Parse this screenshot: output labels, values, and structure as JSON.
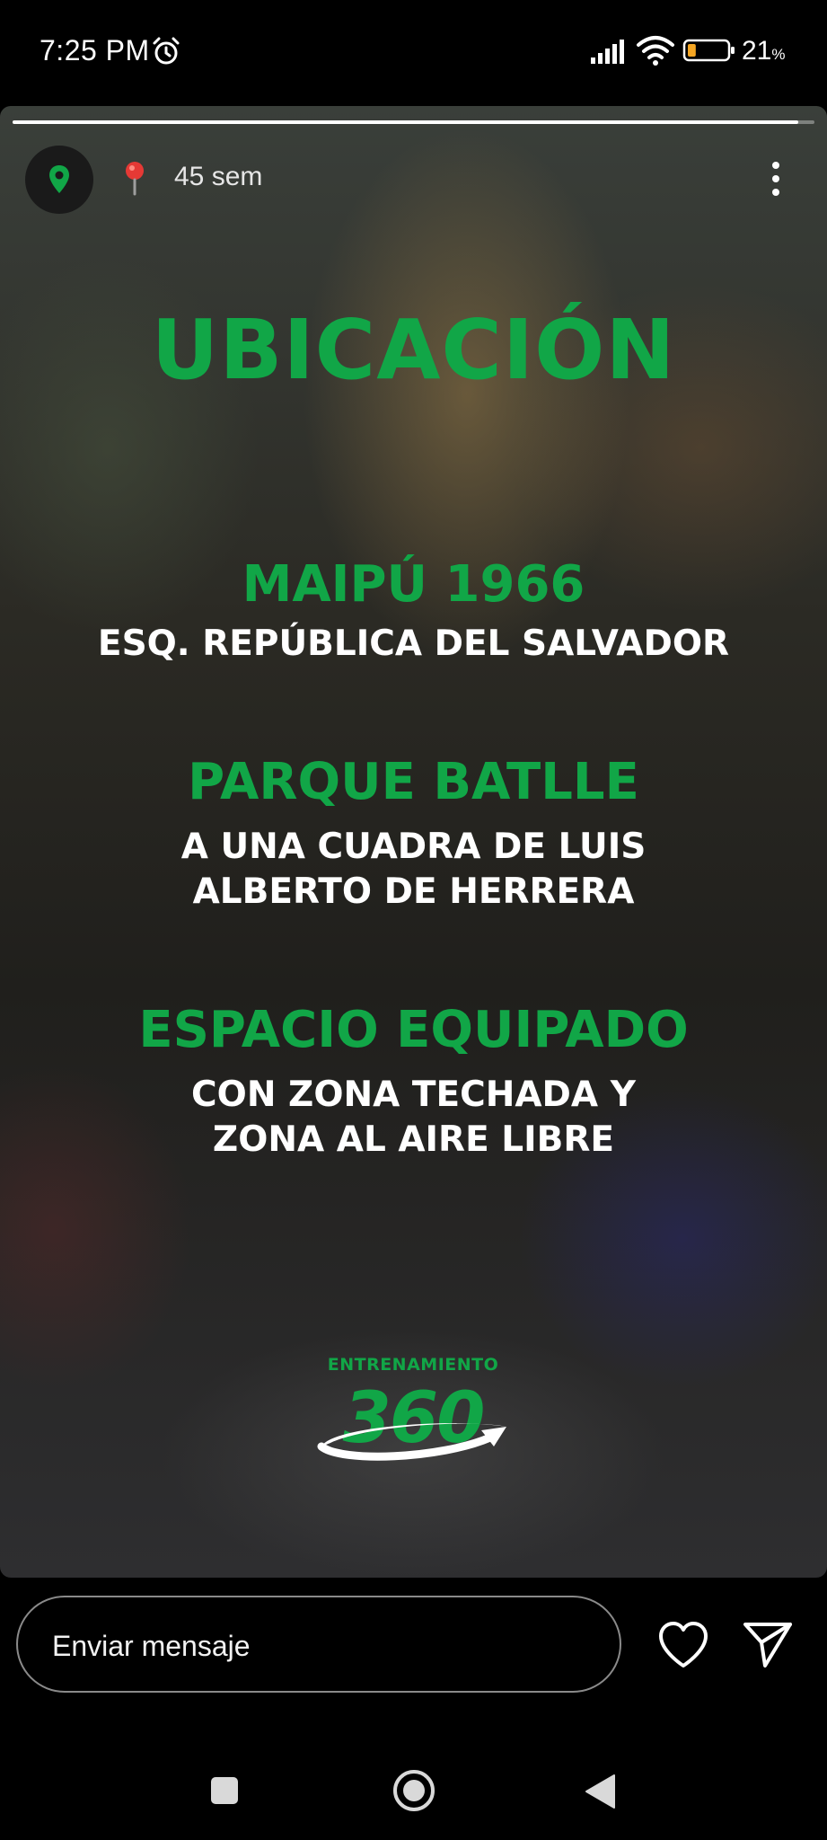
{
  "status_bar": {
    "time": "7:25 PM",
    "battery_percent": "21",
    "battery_unit": "%",
    "battery_level": 0.21,
    "icons": [
      "alarm-icon",
      "signal-icon",
      "wifi-icon",
      "battery-icon"
    ]
  },
  "story": {
    "progress_fraction": 0.98,
    "location_badge_icon": "map-pin-icon",
    "time_ago": "45 sem",
    "title": "UBICACIÓN",
    "sections": [
      {
        "heading": "MAIPÚ 1966",
        "lines": [
          "ESQ. REPÚBLICA DEL SALVADOR"
        ]
      },
      {
        "heading": "PARQUE BATLLE",
        "lines": [
          "A UNA CUADRA DE LUIS",
          "ALBERTO DE HERRERA"
        ]
      },
      {
        "heading": "ESPACIO EQUIPADO",
        "lines": [
          "CON ZONA TECHADA Y",
          "ZONA AL AIRE LIBRE"
        ]
      }
    ],
    "logo": {
      "top_text": "ENTRENAMIENTO",
      "number": "360"
    },
    "accent_color": "#11a647"
  },
  "reply_bar": {
    "placeholder": "Enviar mensaje",
    "icons": [
      "heart-icon",
      "send-icon"
    ]
  },
  "nav_bar": {
    "icons": [
      "recents-icon",
      "home-icon",
      "back-icon"
    ]
  }
}
